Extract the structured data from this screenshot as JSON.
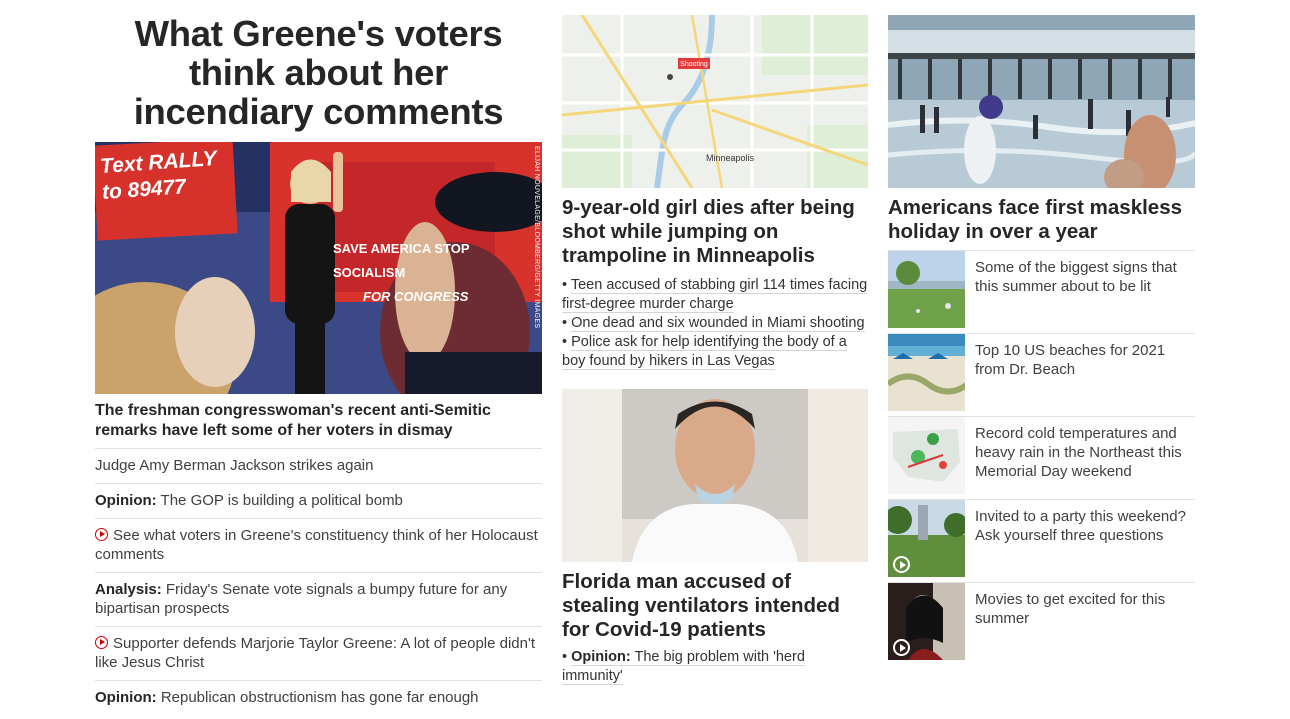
{
  "col1": {
    "headline": "What Greene's voters think about her incendiary comments",
    "photo_credit": "ELIJAH NOUVELAGE/BLOOMBERG/GETTY IMAGES",
    "sign_text": [
      "Text RALLY",
      "to 89477"
    ],
    "banner_text": [
      "SAVE AMERICA STOP SOCIALISM",
      "FOR CONGRESS"
    ],
    "caption": "The freshman congresswoman's recent anti-Semitic remarks have left some of her voters in dismay",
    "links": [
      {
        "prefix": "",
        "text": "Judge Amy Berman Jackson strikes again",
        "icon": ""
      },
      {
        "prefix": "Opinion:",
        "text": " The GOP is building a political bomb",
        "icon": ""
      },
      {
        "prefix": "",
        "text": "See what voters in Greene's constituency think of her Holocaust comments",
        "icon": "play-icon"
      },
      {
        "prefix": "Analysis:",
        "text": " Friday's Senate vote signals a bumpy future for any bipartisan prospects",
        "icon": ""
      },
      {
        "prefix": "",
        "text": "Supporter defends Marjorie Taylor Greene: A lot of people didn't like Jesus Christ",
        "icon": "play-icon"
      },
      {
        "prefix": "Opinion:",
        "text": " Republican obstructionism has gone far enough",
        "icon": ""
      }
    ]
  },
  "col2": {
    "map": {
      "marker_label": "Shooting",
      "city_label": "Minneapolis"
    },
    "story1": {
      "headline": "9-year-old girl dies after being shot while jumping on trampoline in Minneapolis",
      "bullets": [
        "Teen accused of stabbing girl 114 times facing first-degree murder charge",
        "One dead and six wounded in Miami shooting",
        "Police ask for help identifying the body of a boy found by hikers in Las Vegas"
      ]
    },
    "story2": {
      "headline": "Florida man accused of stealing ventilators intended for Covid-19 patients",
      "bullet_prefix": "Opinion:",
      "bullet_text": " The big problem with 'herd immunity'"
    }
  },
  "col3": {
    "headline": "Americans face first maskless holiday in over a year",
    "items": [
      {
        "text": "Some of the biggest signs that this summer about to be lit",
        "video": false
      },
      {
        "text": "Top 10 US beaches for 2021 from Dr. Beach",
        "video": false
      },
      {
        "text": "Record cold temperatures and heavy rain in the Northeast this Memorial Day weekend",
        "video": false
      },
      {
        "text": "Invited to a party this weekend? Ask yourself three questions",
        "video": true
      },
      {
        "text": "Movies to get excited for this summer",
        "video": true
      }
    ]
  },
  "colors": {
    "accent_red": "#cc0000",
    "text_dark": "#262626",
    "divider": "#e1e1e1"
  }
}
